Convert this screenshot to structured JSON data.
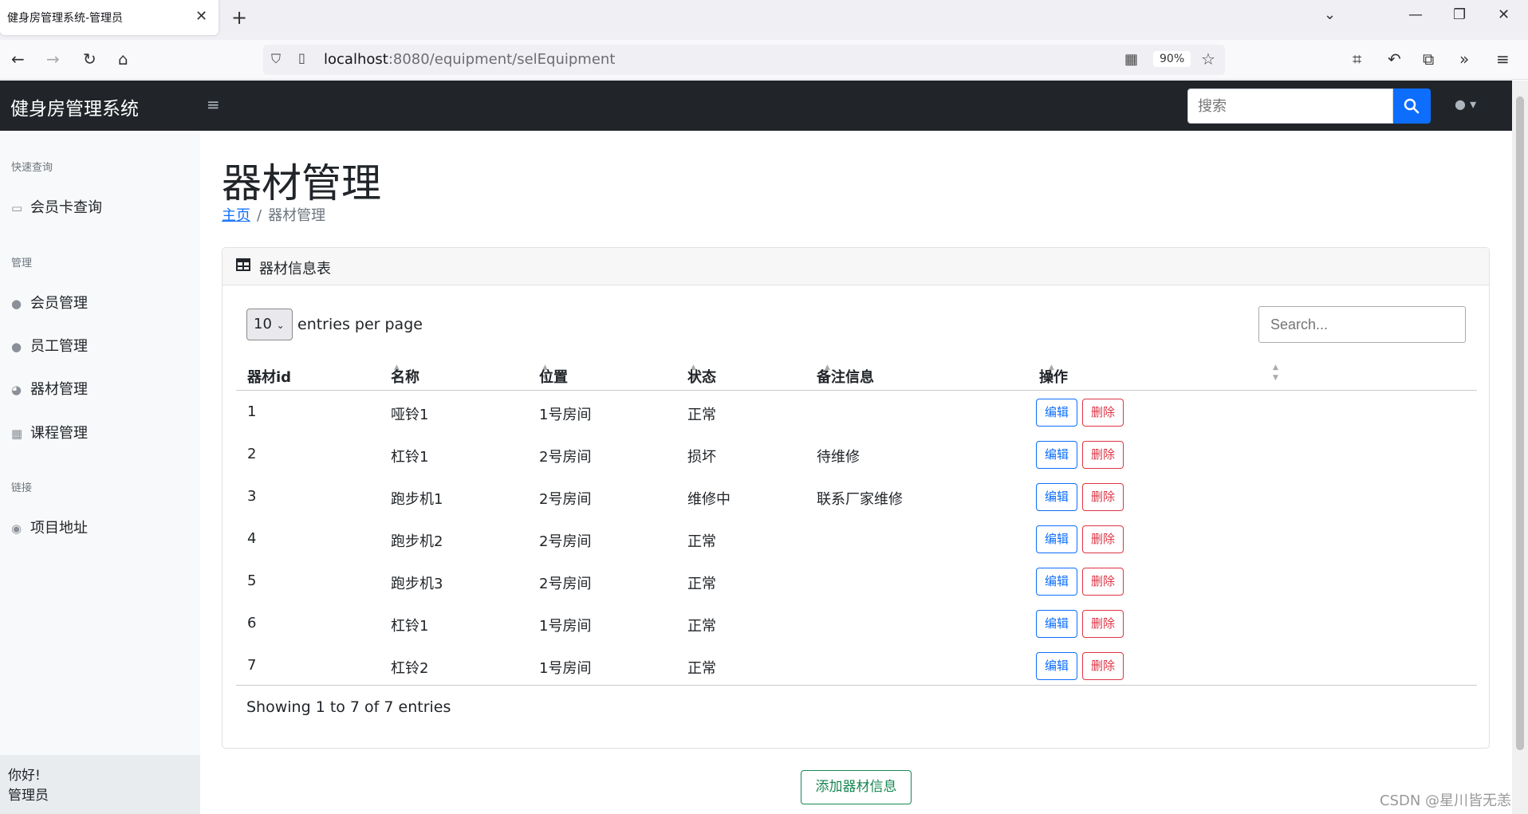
{
  "browser": {
    "tab_title": "健身房管理系统-管理员",
    "url_host": "localhost",
    "url_path": ":8080/equipment/selEquipment",
    "zoom": "90%"
  },
  "app": {
    "brand": "健身房管理系统",
    "search_placeholder": "搜索"
  },
  "sidebar": {
    "sections": [
      {
        "heading": "快速查询",
        "items": [
          {
            "label": "会员卡查询",
            "icon": "id-card-icon"
          }
        ]
      },
      {
        "heading": "管理",
        "items": [
          {
            "label": "会员管理",
            "icon": "user-icon"
          },
          {
            "label": "员工管理",
            "icon": "user-tie-icon"
          },
          {
            "label": "器材管理",
            "icon": "table-tennis-icon"
          },
          {
            "label": "课程管理",
            "icon": "calendar-icon"
          }
        ]
      },
      {
        "heading": "链接",
        "items": [
          {
            "label": "项目地址",
            "icon": "github-icon"
          }
        ]
      }
    ],
    "footer_greeting": "你好!",
    "footer_user": "管理员"
  },
  "main": {
    "title": "器材管理",
    "breadcrumb_home": "主页",
    "breadcrumb_current": "器材管理",
    "card_title": "器材信息表",
    "per_page_value": "10",
    "per_page_label": "entries per page",
    "search_placeholder": "Search...",
    "columns": [
      "器材id",
      "名称",
      "位置",
      "状态",
      "备注信息",
      "操作"
    ],
    "rows": [
      {
        "id": "1",
        "name": "哑铃1",
        "location": "1号房间",
        "status": "正常",
        "note": ""
      },
      {
        "id": "2",
        "name": "杠铃1",
        "location": "2号房间",
        "status": "损坏",
        "note": "待维修"
      },
      {
        "id": "3",
        "name": "跑步机1",
        "location": "2号房间",
        "status": "维修中",
        "note": "联系厂家维修"
      },
      {
        "id": "4",
        "name": "跑步机2",
        "location": "2号房间",
        "status": "正常",
        "note": ""
      },
      {
        "id": "5",
        "name": "跑步机3",
        "location": "2号房间",
        "status": "正常",
        "note": ""
      },
      {
        "id": "6",
        "name": "杠铃1",
        "location": "1号房间",
        "status": "正常",
        "note": ""
      },
      {
        "id": "7",
        "name": "杠铃2",
        "location": "1号房间",
        "status": "正常",
        "note": ""
      }
    ],
    "edit_label": "编辑",
    "delete_label": "删除",
    "showing_text": "Showing 1 to 7 of 7 entries",
    "add_button": "添加器材信息"
  },
  "watermark": "CSDN @星川皆无恙",
  "colors": {
    "primary": "#0d6efd",
    "danger": "#dc3545",
    "success": "#198754",
    "header_bg": "#212529"
  }
}
